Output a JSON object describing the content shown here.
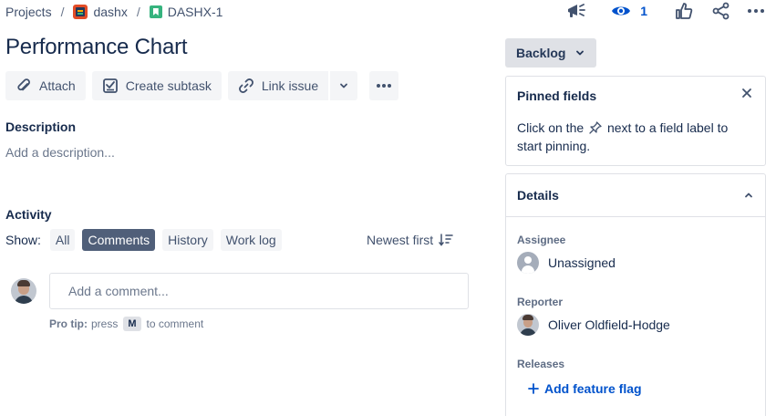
{
  "breadcrumbs": {
    "projects": "Projects",
    "separator": "/",
    "project": "dashx",
    "issue_key": "DASHX-1"
  },
  "top_actions": {
    "watch_count": "1",
    "icons": [
      "megaphone-icon",
      "eye-icon",
      "thumbs-up-icon",
      "share-icon",
      "more-icon"
    ]
  },
  "issue": {
    "title": "Performance Chart"
  },
  "toolbar": {
    "attach": "Attach",
    "create_subtask": "Create subtask",
    "link_issue": "Link issue"
  },
  "description": {
    "label": "Description",
    "placeholder": "Add a description..."
  },
  "activity": {
    "label": "Activity",
    "show_label": "Show:",
    "filters": [
      "All",
      "Comments",
      "History",
      "Work log"
    ],
    "active_filter": "Comments",
    "sort_label": "Newest first",
    "comment_placeholder": "Add a comment...",
    "protip_bold": "Pro tip:",
    "protip_press": "press",
    "protip_key": "M",
    "protip_rest": "to comment"
  },
  "status": {
    "label": "Backlog"
  },
  "pinned": {
    "title": "Pinned fields",
    "text_before": "Click on the",
    "text_after": "next to a field label to start pinning."
  },
  "details": {
    "title": "Details",
    "assignee_label": "Assignee",
    "assignee_value": "Unassigned",
    "reporter_label": "Reporter",
    "reporter_value": "Oliver Oldfield-Hodge",
    "releases_label": "Releases",
    "add_feature_flag": "Add feature flag"
  },
  "colors": {
    "primary": "#0052cc",
    "text": "#172b4d",
    "subtle": "#42526e",
    "active_filter_bg": "#505f79"
  }
}
